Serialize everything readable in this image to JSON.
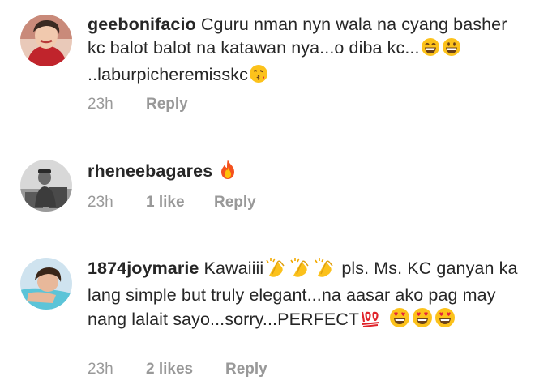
{
  "comments": [
    {
      "username": "geebonifacio",
      "text1": "Cguru nman nyn wala na cyang basher kc balot balot na katawan nya...o diba kc...",
      "text2": "..laburpicheremisskc",
      "emojis": [
        "grinning-smiling-eyes-emoji",
        "grinning-face-emoji",
        "face-blowing-kiss-emoji"
      ],
      "time": "23h",
      "likes": "",
      "reply": "Reply"
    },
    {
      "username": "rheneebagares",
      "text1": "",
      "emojis": [
        "fire-emoji"
      ],
      "time": "23h",
      "likes": "1 like",
      "reply": "Reply"
    },
    {
      "username": "1874joymarie",
      "text1": "Kawaiiii",
      "text2": "pls. Ms. KC ganyan ka lang simple but truly elegant...na aasar ako pag may nang lalait sayo...sorry...PERFECT",
      "emojis": [
        "clapping-hands-emoji",
        "clapping-hands-emoji",
        "clapping-hands-emoji",
        "hundred-points-emoji",
        "heart-eyes-emoji",
        "heart-eyes-emoji",
        "heart-eyes-emoji"
      ],
      "time": "23h",
      "likes": "2 likes",
      "reply": "Reply"
    }
  ]
}
